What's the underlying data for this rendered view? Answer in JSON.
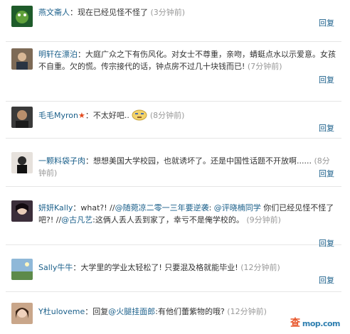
{
  "comments": [
    {
      "name": "燕文斋人",
      "sep": "：",
      "text": "现在已经见怪不怪了",
      "time": "(3分钟前)",
      "reply": "回复",
      "avatar": "avatar-green-frog"
    },
    {
      "name": "明轩在漂泊",
      "sep": "：",
      "text": "大庭广众之下有伤风化。对女士不尊重，亲吻，蜻蜓点水以示爱意。女孩不自重。欠的慌。传宗接代的话，钟点房不过几十块钱而已!",
      "time": "(7分钟前)",
      "reply": "回复",
      "avatar": "avatar-man-photo"
    },
    {
      "name": "毛毛Myron",
      "sep": "：",
      "text": "不太好吧..",
      "time": "(8分钟前)",
      "reply": "回复",
      "avatar": "avatar-man-dark",
      "emoji": "smiley-face-icon"
    },
    {
      "name": "一颗料袋子肉",
      "sep": "：",
      "text": "想想美国大学校园，也就诱坏了。还是中国性话题不开放啊......",
      "time": "(8分钟前)",
      "reply": "回复",
      "avatar": "avatar-person-black"
    },
    {
      "name": "妍妍Kally",
      "sep": "：",
      "text_a": "what?! //",
      "mention_a": "@随菀凉二零一三年要逆袭",
      "text_b": ": ",
      "mention_b": "@评晓楠同学",
      "text_c": " 你们已经见怪不怪了吧?! //",
      "mention_c": "@古凡艺",
      "text_d": ":这俩人丢人丢到家了，幸亏不是俺学校的。",
      "time": "(9分钟前)",
      "reply": "回复",
      "avatar": "avatar-girl-dark"
    },
    {
      "name": "Sally牛牛",
      "sep": "：",
      "text": "大学里的学业太轻松了! 只要混及格就能毕业!",
      "time": "(12分钟前)",
      "reply": "回复",
      "avatar": "avatar-landscape"
    },
    {
      "name": "Y杜uloveme",
      "sep": "：",
      "text_a": "回复",
      "mention_a": "@火腿挂面郎",
      "text_b": ":有他们蕾紫物的哦?",
      "time": "(12分钟前)",
      "reply": "回复",
      "avatar": "avatar-girl-photo"
    }
  ],
  "watermark": {
    "left": "查",
    "right": "mop.com"
  }
}
